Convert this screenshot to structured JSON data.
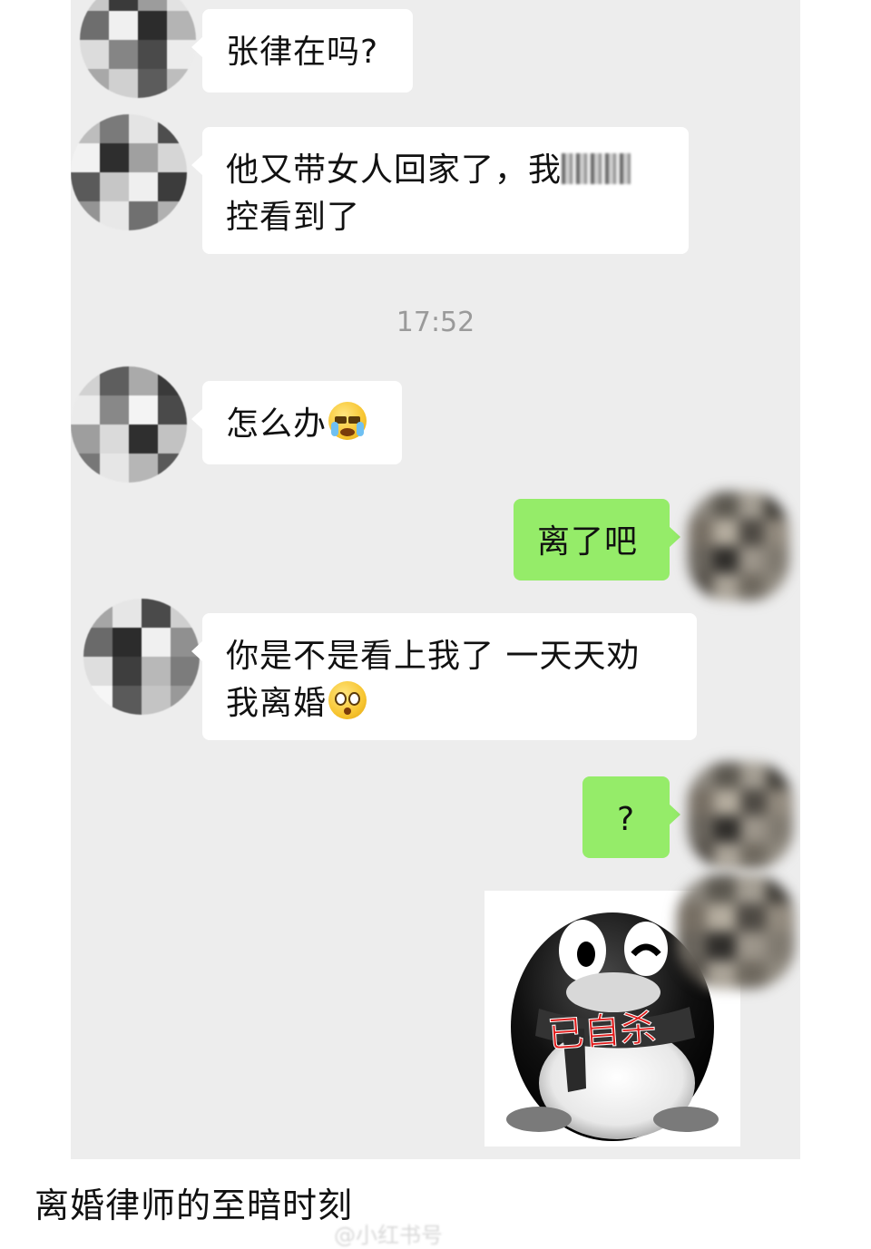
{
  "messages": [
    {
      "id": "m1",
      "side": "left",
      "text": "张律在吗?"
    },
    {
      "id": "m2",
      "side": "left",
      "line1": "他又带女人回家了，我",
      "line2": "控看到了",
      "redacted": "监"
    },
    {
      "id": "m3",
      "side": "left",
      "text": "怎么办",
      "emoji": "loudly-crying-face"
    },
    {
      "id": "m4",
      "side": "right",
      "text": "离了吧"
    },
    {
      "id": "m5",
      "side": "left",
      "line1": "你是不是看上我了 一天天劝",
      "line2": "我离婚",
      "emoji": "flushed-face"
    },
    {
      "id": "m6",
      "side": "right",
      "text": "?"
    },
    {
      "id": "m7",
      "side": "right",
      "sticker": "qq-penguin-sticker",
      "sticker_text": "已自杀"
    }
  ],
  "timestamp": "17:52",
  "caption": "离婚律师的至暗时刻",
  "watermark": "@小红书号",
  "colors": {
    "chat_bg": "#ededed",
    "bubble_left": "#ffffff",
    "bubble_right": "#95ec69",
    "timestamp": "#9a9a9a",
    "sticker_text": "#e11a1a"
  }
}
